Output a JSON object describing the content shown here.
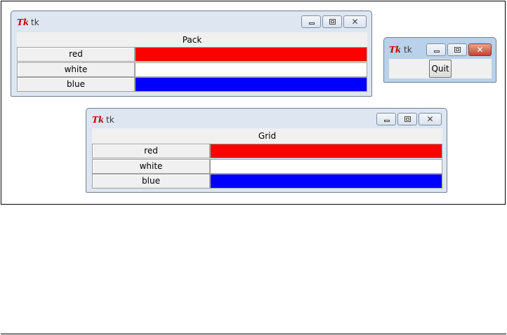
{
  "windows": {
    "pack": {
      "title": "tk",
      "heading": "Pack",
      "rows": [
        {
          "label": "red",
          "color": "#ff0000"
        },
        {
          "label": "white",
          "color": "#ffffff"
        },
        {
          "label": "blue",
          "color": "#0000ff"
        }
      ]
    },
    "quit": {
      "title": "tk",
      "quit_label": "Quit"
    },
    "grid": {
      "title": "tk",
      "heading": "Grid",
      "rows": [
        {
          "label": "red",
          "color": "#ff0000"
        },
        {
          "label": "white",
          "color": "#ffffff"
        },
        {
          "label": "blue",
          "color": "#0000ff"
        }
      ]
    }
  },
  "icons": {
    "app": "tk-feather-icon",
    "minimize": "minimize-icon",
    "maximize": "maximize-icon",
    "close": "close-icon"
  }
}
